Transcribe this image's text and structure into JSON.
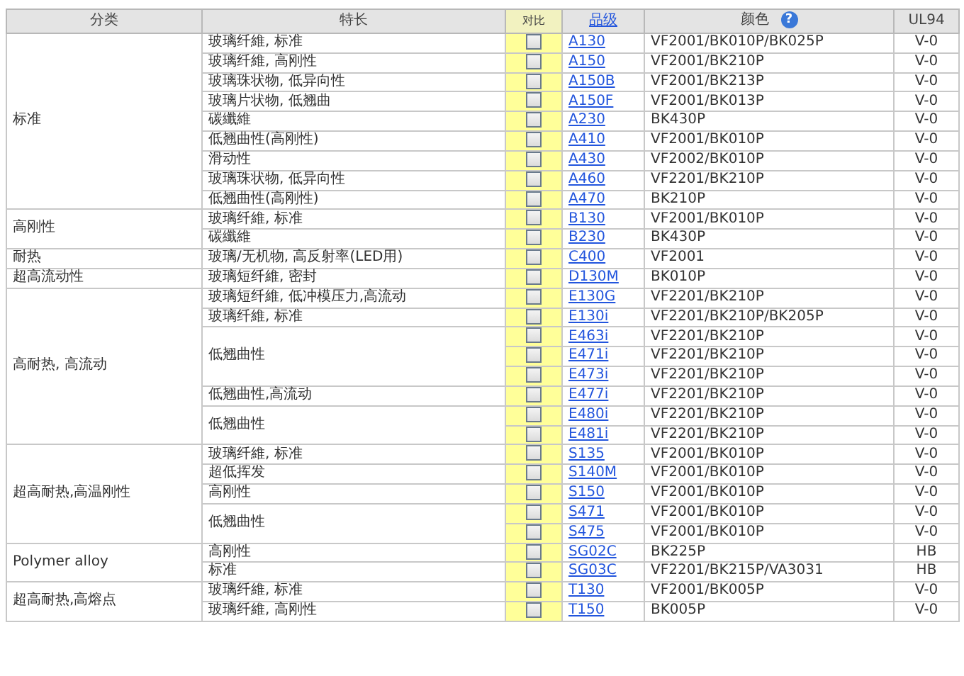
{
  "table": {
    "columns": [
      {
        "label": "分类",
        "kind": "plain"
      },
      {
        "label": "特长",
        "kind": "plain"
      },
      {
        "label": "对比",
        "kind": "small"
      },
      {
        "label": "品级",
        "kind": "link"
      },
      {
        "label": "颜色",
        "kind": "help",
        "help": "?"
      },
      {
        "label": "UL94",
        "kind": "plain"
      }
    ],
    "groups": [
      {
        "category": "标准",
        "features": [
          {
            "text": "玻璃纤維, 标准",
            "products": [
              {
                "grade": "A130",
                "color_code": "VF2001/BK010P/BK025P",
                "ul94": "V-0",
                "checked": false
              }
            ]
          },
          {
            "text": "玻璃纤維, 高刚性",
            "products": [
              {
                "grade": "A150",
                "color_code": "VF2001/BK210P",
                "ul94": "V-0",
                "checked": false
              }
            ]
          },
          {
            "text": "玻璃珠状物, 低异向性",
            "products": [
              {
                "grade": "A150B",
                "color_code": "VF2001/BK213P",
                "ul94": "V-0",
                "checked": false
              }
            ]
          },
          {
            "text": "玻璃片状物, 低翘曲",
            "products": [
              {
                "grade": "A150F",
                "color_code": "VF2001/BK013P",
                "ul94": "V-0",
                "checked": false
              }
            ]
          },
          {
            "text": "碳纖維",
            "products": [
              {
                "grade": "A230",
                "color_code": "BK430P",
                "ul94": "V-0",
                "checked": false
              }
            ]
          },
          {
            "text": "低翘曲性(高刚性)",
            "products": [
              {
                "grade": "A410",
                "color_code": "VF2001/BK010P",
                "ul94": "V-0",
                "checked": false
              }
            ]
          },
          {
            "text": "滑动性",
            "products": [
              {
                "grade": "A430",
                "color_code": "VF2002/BK010P",
                "ul94": "V-0",
                "checked": false
              }
            ]
          },
          {
            "text": "玻璃珠状物, 低异向性",
            "products": [
              {
                "grade": "A460",
                "color_code": "VF2201/BK210P",
                "ul94": "V-0",
                "checked": false
              }
            ]
          },
          {
            "text": "低翘曲性(高刚性)",
            "products": [
              {
                "grade": "A470",
                "color_code": "BK210P",
                "ul94": "V-0",
                "checked": false
              }
            ]
          }
        ]
      },
      {
        "category": "高刚性",
        "features": [
          {
            "text": "玻璃纤維, 标准",
            "products": [
              {
                "grade": "B130",
                "color_code": "VF2001/BK010P",
                "ul94": "V-0",
                "checked": false
              }
            ]
          },
          {
            "text": "碳纖維",
            "products": [
              {
                "grade": "B230",
                "color_code": "BK430P",
                "ul94": "V-0",
                "checked": false
              }
            ]
          }
        ]
      },
      {
        "category": "耐热",
        "features": [
          {
            "text": "玻璃/无机物, 高反射率(LED用)",
            "products": [
              {
                "grade": "C400",
                "color_code": "VF2001",
                "ul94": "V-0",
                "checked": false
              }
            ]
          }
        ]
      },
      {
        "category": "超高流动性",
        "features": [
          {
            "text": "玻璃短纤維, 密封",
            "products": [
              {
                "grade": "D130M",
                "color_code": "BK010P",
                "ul94": "V-0",
                "checked": false
              }
            ]
          }
        ]
      },
      {
        "category": "高耐热, 高流动",
        "features": [
          {
            "text": "玻璃短纤維, 低冲模压力,高流动",
            "products": [
              {
                "grade": "E130G",
                "color_code": "VF2201/BK210P",
                "ul94": "V-0",
                "checked": false
              }
            ]
          },
          {
            "text": "玻璃纤維, 标准",
            "products": [
              {
                "grade": "E130i",
                "color_code": "VF2201/BK210P/BK205P",
                "ul94": "V-0",
                "checked": false
              }
            ]
          },
          {
            "text": "低翘曲性",
            "products": [
              {
                "grade": "E463i",
                "color_code": "VF2201/BK210P",
                "ul94": "V-0",
                "checked": false
              },
              {
                "grade": "E471i",
                "color_code": "VF2201/BK210P",
                "ul94": "V-0",
                "checked": false
              },
              {
                "grade": "E473i",
                "color_code": "VF2201/BK210P",
                "ul94": "V-0",
                "checked": false
              }
            ]
          },
          {
            "text": "低翘曲性,高流动",
            "products": [
              {
                "grade": "E477i",
                "color_code": "VF2201/BK210P",
                "ul94": "V-0",
                "checked": false
              }
            ]
          },
          {
            "text": "低翘曲性",
            "products": [
              {
                "grade": "E480i",
                "color_code": "VF2201/BK210P",
                "ul94": "V-0",
                "checked": false
              },
              {
                "grade": "E481i",
                "color_code": "VF2201/BK210P",
                "ul94": "V-0",
                "checked": false
              }
            ]
          }
        ]
      },
      {
        "category": "超高耐热,高温刚性",
        "features": [
          {
            "text": "玻璃纤維, 标准",
            "products": [
              {
                "grade": "S135",
                "color_code": "VF2001/BK010P",
                "ul94": "V-0",
                "checked": false
              }
            ]
          },
          {
            "text": "超低挥发",
            "products": [
              {
                "grade": "S140M",
                "color_code": "VF2001/BK010P",
                "ul94": "V-0",
                "checked": false
              }
            ]
          },
          {
            "text": "高刚性",
            "products": [
              {
                "grade": "S150",
                "color_code": "VF2001/BK010P",
                "ul94": "V-0",
                "checked": false
              }
            ]
          },
          {
            "text": "低翘曲性",
            "products": [
              {
                "grade": "S471",
                "color_code": "VF2001/BK010P",
                "ul94": "V-0",
                "checked": false
              },
              {
                "grade": "S475",
                "color_code": "VF2001/BK010P",
                "ul94": "V-0",
                "checked": false
              }
            ]
          }
        ]
      },
      {
        "category": "Polymer alloy",
        "features": [
          {
            "text": "高刚性",
            "products": [
              {
                "grade": "SG02C",
                "color_code": "BK225P",
                "ul94": "HB",
                "checked": false
              }
            ]
          },
          {
            "text": "标准",
            "products": [
              {
                "grade": "SG03C",
                "color_code": "VF2201/BK215P/VA3031",
                "ul94": "HB",
                "checked": false
              }
            ]
          }
        ]
      },
      {
        "category": "超高耐热,高熔点",
        "features": [
          {
            "text": "玻璃纤維, 标准",
            "products": [
              {
                "grade": "T130",
                "color_code": "VF2001/BK005P",
                "ul94": "V-0",
                "checked": false
              }
            ]
          },
          {
            "text": "玻璃纤維, 高刚性",
            "products": [
              {
                "grade": "T150",
                "color_code": "BK005P",
                "ul94": "V-0",
                "checked": false
              }
            ]
          }
        ]
      }
    ]
  }
}
